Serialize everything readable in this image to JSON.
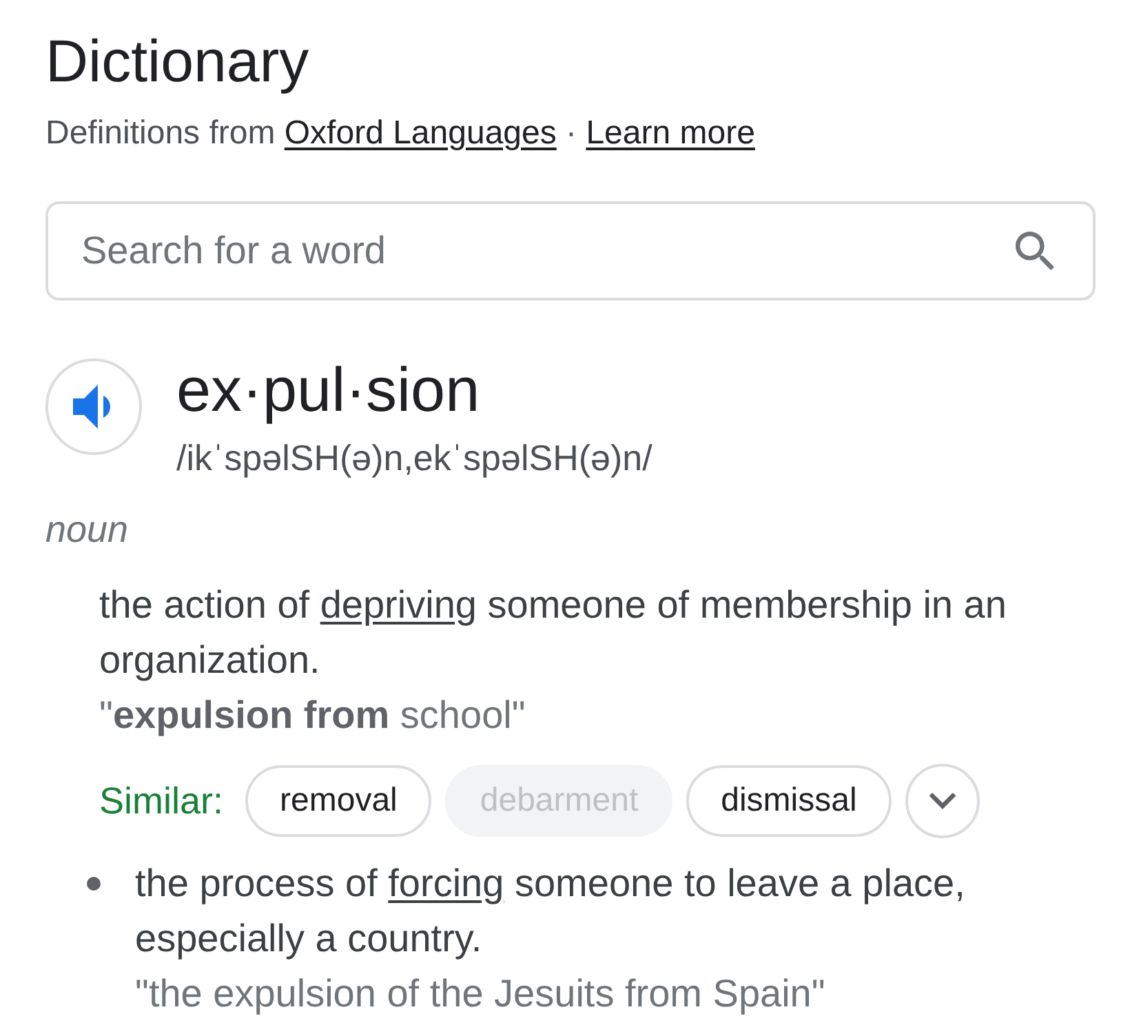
{
  "header": {
    "title": "Dictionary",
    "source": {
      "prefix": "Definitions from",
      "link": "Oxford Languages",
      "separator": "·",
      "more_link": "Learn more"
    }
  },
  "search": {
    "placeholder": "Search for a word"
  },
  "entry": {
    "word": "ex·pul·sion",
    "pronunciation": "/ikˈspəlSH(ə)n,ekˈspəlSH(ə)n/",
    "part_of_speech": "noun",
    "senses": [
      {
        "bulleted": false,
        "definition": [
          {
            "kind": "text",
            "text": "the action of"
          },
          {
            "kind": "link",
            "text": "depriving"
          },
          {
            "kind": "text",
            "text": "someone of membership in an organization."
          }
        ],
        "example": "\"**expulsion from** school\"",
        "similar": {
          "label": "Similar:",
          "chips": [
            {
              "text": "removal",
              "disabled": false
            },
            {
              "text": "debarment",
              "disabled": true
            },
            {
              "text": "dismissal",
              "disabled": false
            }
          ],
          "more_expanded": false
        }
      },
      {
        "bulleted": true,
        "definition": [
          {
            "kind": "text",
            "text": "the process of"
          },
          {
            "kind": "link",
            "text": "forcing"
          },
          {
            "kind": "text",
            "text": "someone to leave a place, especially a country."
          }
        ],
        "example": "\"the expulsion of the Jesuits from Spain\""
      }
    ]
  }
}
